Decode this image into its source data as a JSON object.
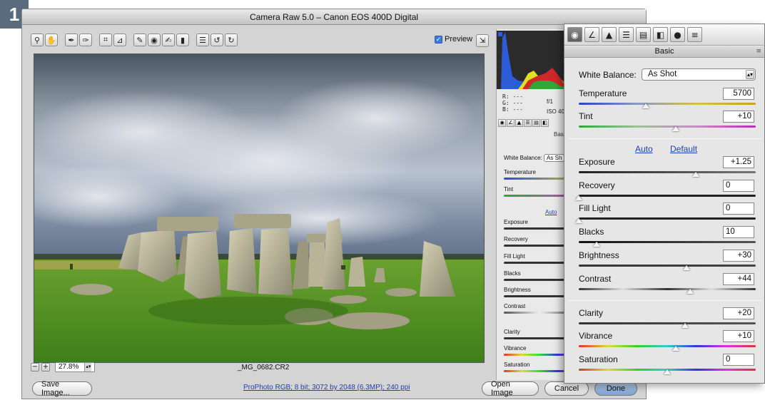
{
  "step_badge": "1",
  "window": {
    "title": "Camera Raw 5.0  –  Canon EOS 400D Digital"
  },
  "toolbar": {
    "tools": [
      {
        "name": "zoom-tool-icon",
        "glyph": "⚲"
      },
      {
        "name": "hand-tool-icon",
        "glyph": "✋"
      },
      {
        "name": "white-balance-tool-icon",
        "glyph": "✒"
      },
      {
        "name": "color-sampler-icon",
        "glyph": "✑"
      },
      {
        "name": "crop-tool-icon",
        "glyph": "⌗"
      },
      {
        "name": "straighten-tool-icon",
        "glyph": "⊿"
      },
      {
        "name": "retouch-tool-icon",
        "glyph": "✎"
      },
      {
        "name": "red-eye-tool-icon",
        "glyph": "◉"
      },
      {
        "name": "adjustment-brush-icon",
        "glyph": "✍"
      },
      {
        "name": "graduated-filter-icon",
        "glyph": "▮"
      },
      {
        "name": "preferences-icon",
        "glyph": "☰"
      },
      {
        "name": "rotate-left-icon",
        "glyph": "↺"
      },
      {
        "name": "rotate-right-icon",
        "glyph": "↻"
      }
    ]
  },
  "preview": {
    "label": "Preview",
    "checked": true
  },
  "status": {
    "zoom": "27.8%",
    "filename": "_MG_0682.CR2"
  },
  "footer": {
    "save_label": "Save Image...",
    "workflow": "ProPhoto RGB; 8 bit; 3072 by 2048 (6.3MP); 240 ppi",
    "open_label": "Open Image",
    "cancel_label": "Cancel",
    "done_label": "Done"
  },
  "info": {
    "r": "R:  ---",
    "g": "G:  ---",
    "b": "B:  ---",
    "aperture": "f/1",
    "iso": "ISO 40"
  },
  "small_panel": {
    "heading": "Bas",
    "wb_label": "White Balance:",
    "wb_value": "As Sh",
    "auto": "Auto",
    "labels": [
      "Temperature",
      "Tint",
      "Exposure",
      "Recovery",
      "Fill Light",
      "Blacks",
      "Brightness",
      "Contrast",
      "Clarity",
      "Vibrance",
      "Saturation"
    ]
  },
  "basic": {
    "heading": "Basic",
    "white_balance_label": "White Balance:",
    "white_balance_value": "As Shot",
    "auto_label": "Auto",
    "default_label": "Default",
    "sliders": [
      {
        "key": "temperature",
        "label": "Temperature",
        "value": "5700",
        "fraction": 0.38
      },
      {
        "key": "tint",
        "label": "Tint",
        "value": "+10",
        "fraction": 0.55
      },
      {
        "key": "exposure",
        "label": "Exposure",
        "value": "+1.25",
        "fraction": 0.66
      },
      {
        "key": "recovery",
        "label": "Recovery",
        "value": "0",
        "fraction": 0.0
      },
      {
        "key": "fill-light",
        "label": "Fill Light",
        "value": "0",
        "fraction": 0.0
      },
      {
        "key": "blacks",
        "label": "Blacks",
        "value": "10",
        "fraction": 0.1
      },
      {
        "key": "brightness",
        "label": "Brightness",
        "value": "+30",
        "fraction": 0.61
      },
      {
        "key": "contrast",
        "label": "Contrast",
        "value": "+44",
        "fraction": 0.63
      },
      {
        "key": "clarity",
        "label": "Clarity",
        "value": "+20",
        "fraction": 0.6
      },
      {
        "key": "vibrance",
        "label": "Vibrance",
        "value": "+10",
        "fraction": 0.55
      },
      {
        "key": "saturation",
        "label": "Saturation",
        "value": "0",
        "fraction": 0.5
      }
    ]
  },
  "panel_tabs": [
    "basic-tab-icon",
    "tone-curve-tab-icon",
    "detail-tab-icon",
    "hsl-tab-icon",
    "split-toning-tab-icon",
    "lens-corrections-tab-icon",
    "camera-calibration-tab-icon",
    "presets-tab-icon"
  ]
}
